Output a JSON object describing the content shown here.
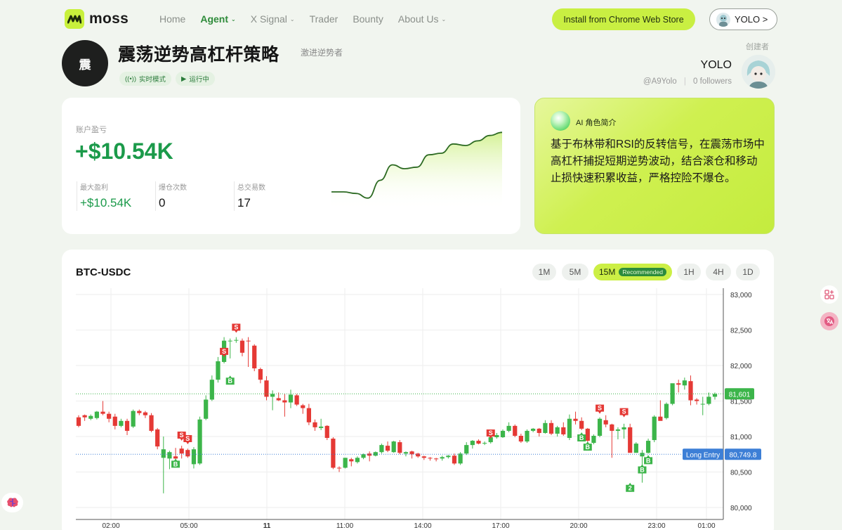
{
  "nav": {
    "brand": "moss",
    "links": [
      {
        "label": "Home",
        "caret": false
      },
      {
        "label": "Agent",
        "caret": true,
        "active": true
      },
      {
        "label": "X Signal",
        "caret": true
      },
      {
        "label": "Trader",
        "caret": false
      },
      {
        "label": "Bounty",
        "caret": false
      },
      {
        "label": "About Us",
        "caret": true
      }
    ],
    "install_label": "Install from Chrome Web Store",
    "user_label": "YOLO >"
  },
  "strategy": {
    "avatar_char": "震",
    "title": "震荡逆势高杠杆策略",
    "subtitle": "激进逆势者",
    "mode_badge": "实时模式",
    "status_badge": "运行中"
  },
  "creator": {
    "label": "创建者",
    "name": "YOLO",
    "handle": "@A9Yolo",
    "followers": "0 followers"
  },
  "pnl": {
    "label": "账户盈亏",
    "value": "+$10.54K",
    "stats": [
      {
        "label": "最大盈利",
        "value": "+$10.54K",
        "green": true
      },
      {
        "label": "爆仓次数",
        "value": "0"
      },
      {
        "label": "总交易数",
        "value": "17"
      }
    ],
    "sparkline": [
      0.2,
      0.2,
      0.18,
      0.12,
      0.35,
      0.55,
      0.5,
      0.52,
      0.68,
      0.7,
      0.82,
      0.8,
      0.86,
      0.93,
      0.97
    ]
  },
  "ai": {
    "title": "AI 角色简介",
    "text": "基于布林带和RSI的反转信号，在震荡市场中高杠杆捕捉短期逆势波动，结合滚仓和移动止损快速积累收益，严格控险不爆仓。"
  },
  "chart": {
    "pair": "BTC-USDC",
    "timeframes": [
      "1M",
      "5M",
      "15M",
      "1H",
      "4H",
      "1D"
    ],
    "selected_timeframe": "15M",
    "recommended_label": "Recommended",
    "current_price_label": "81,601",
    "entry_label": "Long Entry",
    "entry_price_label": "80,749.8"
  },
  "chart_data": {
    "type": "candlestick",
    "title": "",
    "y_axis": {
      "min": 80000,
      "max": 83000,
      "ticks": [
        "83,000",
        "82,500",
        "82,000",
        "81,500",
        "81,000",
        "80,500",
        "80,000"
      ],
      "tick_values": [
        83000,
        82500,
        82000,
        81500,
        81000,
        80500,
        80000
      ]
    },
    "x_ticks": [
      "02:00",
      "05:00",
      "11",
      "11:00",
      "14:00",
      "17:00",
      "20:00",
      "23:00",
      "01:00"
    ],
    "current_price": 81601,
    "long_entry": 80749.8,
    "colors": {
      "up": "#3cb54a",
      "down": "#e53935",
      "grid": "#eeeeee",
      "entry": "#3d7fd6"
    },
    "candles": [
      [
        81270,
        81300,
        81130,
        81150
      ],
      [
        81300,
        81310,
        81220,
        81270
      ],
      [
        81250,
        81310,
        81230,
        81290
      ],
      [
        81260,
        81360,
        81240,
        81350
      ],
      [
        81350,
        81500,
        81300,
        81320
      ],
      [
        81320,
        81350,
        81200,
        81250
      ],
      [
        81280,
        81320,
        81100,
        81150
      ],
      [
        81150,
        81250,
        81130,
        81220
      ],
      [
        81220,
        81250,
        81020,
        81080
      ],
      [
        81140,
        81380,
        81120,
        81360
      ],
      [
        81360,
        81380,
        81300,
        81330
      ],
      [
        81340,
        81360,
        81260,
        81300
      ],
      [
        81300,
        81330,
        81060,
        81080
      ],
      [
        81100,
        81120,
        80820,
        80860
      ],
      [
        80700,
        81000,
        80200,
        80820
      ],
      [
        80690,
        80800,
        80540,
        80780
      ],
      [
        80720,
        80840,
        80600,
        80690
      ],
      [
        80830,
        80870,
        80690,
        80760
      ],
      [
        80810,
        80830,
        80700,
        80720
      ],
      [
        80610,
        80850,
        80550,
        80820
      ],
      [
        80620,
        81280,
        80600,
        81240
      ],
      [
        81250,
        81580,
        81230,
        81520
      ],
      [
        81520,
        81860,
        81500,
        81800
      ],
      [
        81800,
        82120,
        81760,
        82060
      ],
      [
        82050,
        82400,
        82030,
        82350
      ],
      [
        82340,
        82380,
        82100,
        82350
      ],
      [
        82360,
        82400,
        82320,
        82360
      ],
      [
        82350,
        82380,
        82130,
        82180
      ],
      [
        82350,
        82400,
        81980,
        82340
      ],
      [
        82280,
        82300,
        81920,
        81960
      ],
      [
        81950,
        81970,
        81750,
        81800
      ],
      [
        81790,
        81850,
        81510,
        81560
      ],
      [
        81560,
        81650,
        81370,
        81600
      ],
      [
        81540,
        81620,
        81500,
        81510
      ],
      [
        81510,
        81600,
        81280,
        81480
      ],
      [
        81480,
        81660,
        81400,
        81590
      ],
      [
        81580,
        81600,
        81430,
        81450
      ],
      [
        81440,
        81460,
        81320,
        81400
      ],
      [
        81400,
        81460,
        81160,
        81200
      ],
      [
        81200,
        81240,
        81080,
        81130
      ],
      [
        81120,
        81250,
        81090,
        81140
      ],
      [
        81150,
        81160,
        80950,
        80980
      ],
      [
        80970,
        80990,
        80540,
        80560
      ],
      [
        80560,
        80580,
        80500,
        80550
      ],
      [
        80560,
        80700,
        80550,
        80700
      ],
      [
        80680,
        80700,
        80580,
        80650
      ],
      [
        80640,
        80720,
        80620,
        80700
      ],
      [
        80700,
        80760,
        80680,
        80750
      ],
      [
        80760,
        80790,
        80650,
        80730
      ],
      [
        80730,
        80790,
        80720,
        80780
      ],
      [
        80780,
        80900,
        80760,
        80880
      ],
      [
        80870,
        80930,
        80780,
        80800
      ],
      [
        80780,
        80940,
        80770,
        80930
      ],
      [
        80920,
        80950,
        80750,
        80770
      ],
      [
        80760,
        80790,
        80720,
        80780
      ],
      [
        80790,
        80800,
        80690,
        80750
      ],
      [
        80760,
        80770,
        80700,
        80720
      ],
      [
        80720,
        80730,
        80670,
        80700
      ],
      [
        80700,
        80710,
        80660,
        80690
      ],
      [
        80690,
        80700,
        80650,
        80680
      ],
      [
        80690,
        80730,
        80660,
        80710
      ],
      [
        80710,
        80740,
        80690,
        80730
      ],
      [
        80730,
        80760,
        80600,
        80620
      ],
      [
        80620,
        80780,
        80600,
        80760
      ],
      [
        80760,
        80920,
        80740,
        80880
      ],
      [
        80880,
        80950,
        80830,
        80940
      ],
      [
        80940,
        80960,
        80890,
        80900
      ],
      [
        80900,
        80930,
        80880,
        80910
      ],
      [
        80920,
        81010,
        80900,
        80990
      ],
      [
        80990,
        81050,
        80970,
        81020
      ],
      [
        80990,
        81100,
        80980,
        81080
      ],
      [
        81080,
        81200,
        81060,
        81150
      ],
      [
        81150,
        81170,
        80990,
        81010
      ],
      [
        81010,
        81040,
        80910,
        80930
      ],
      [
        80930,
        81100,
        80910,
        81080
      ],
      [
        81080,
        81120,
        81060,
        81110
      ],
      [
        81110,
        81120,
        81000,
        81050
      ],
      [
        81050,
        81230,
        81040,
        81190
      ],
      [
        81190,
        81230,
        81020,
        81040
      ],
      [
        81040,
        81150,
        81000,
        81130
      ],
      [
        81130,
        81200,
        81010,
        81030
      ],
      [
        80980,
        81310,
        80950,
        81250
      ],
      [
        81250,
        81350,
        81170,
        81220
      ],
      [
        81220,
        81270,
        81090,
        81110
      ],
      [
        81110,
        81120,
        80920,
        80940
      ],
      [
        80910,
        81030,
        80890,
        81010
      ],
      [
        81010,
        81270,
        80990,
        81250
      ],
      [
        81230,
        81300,
        81130,
        81170
      ],
      [
        81170,
        81180,
        80700,
        81080
      ],
      [
        81080,
        81130,
        80960,
        81100
      ],
      [
        81100,
        81180,
        80970,
        81130
      ],
      [
        81130,
        81180,
        80810,
        80770
      ],
      [
        80770,
        80920,
        80780,
        80900
      ],
      [
        80720,
        80810,
        80350,
        80770
      ],
      [
        80770,
        80970,
        80760,
        80940
      ],
      [
        80950,
        81300,
        80920,
        81280
      ],
      [
        81280,
        81510,
        81260,
        81220
      ],
      [
        81260,
        81480,
        81240,
        81460
      ],
      [
        81460,
        81740,
        81440,
        81750
      ],
      [
        81750,
        81800,
        81620,
        81730
      ],
      [
        81720,
        81830,
        81660,
        81790
      ],
      [
        81780,
        81860,
        81440,
        81510
      ],
      [
        81520,
        81540,
        81450,
        81500
      ],
      [
        81450,
        81560,
        81300,
        81460
      ],
      [
        81460,
        81620,
        81440,
        81560
      ],
      [
        81560,
        81620,
        81520,
        81600
      ]
    ],
    "signals": [
      {
        "index": 17,
        "type": "S",
        "price": 81000
      },
      {
        "index": 18,
        "type": "S",
        "price": 80950
      },
      {
        "index": 16,
        "type": "B",
        "price": 80630
      },
      {
        "index": 26,
        "type": "S",
        "price": 82520
      },
      {
        "index": 24,
        "type": "S",
        "price": 82180
      },
      {
        "index": 25,
        "type": "B",
        "price": 81800
      },
      {
        "index": 68,
        "type": "S",
        "price": 81030
      },
      {
        "index": 83,
        "type": "B",
        "price": 81000
      },
      {
        "index": 84,
        "type": "B",
        "price": 80870
      },
      {
        "index": 86,
        "type": "S",
        "price": 81380
      },
      {
        "index": 90,
        "type": "S",
        "price": 81330
      },
      {
        "index": 93,
        "type": "B",
        "price": 80550
      },
      {
        "index": 94,
        "type": "B",
        "price": 80680
      },
      {
        "index": 91,
        "type": "2",
        "price": 80290
      }
    ]
  }
}
